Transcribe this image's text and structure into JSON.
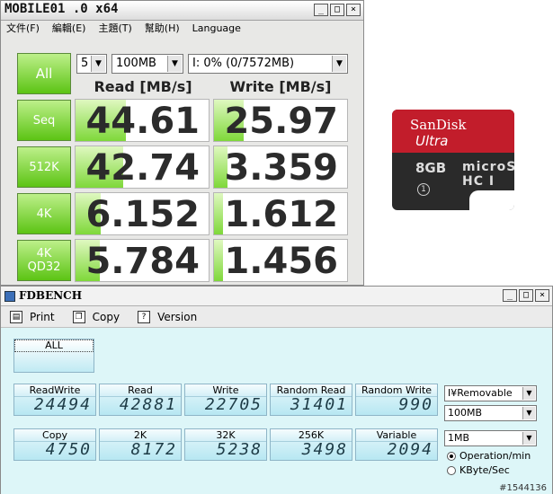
{
  "crystaldiskmark": {
    "title": "MOBILE01 .0 x64",
    "menu": [
      "文件(F)",
      "編輯(E)",
      "主題(T)",
      "幫助(H)",
      "Language"
    ],
    "all_label": "All",
    "count_select": "5",
    "size_select": "100MB",
    "drive_select": "I: 0% (0/7572MB)",
    "read_header": "Read [MB/s]",
    "write_header": "Write [MB/s]",
    "rows": [
      {
        "label": "Seq",
        "label2": "",
        "read": "44.61",
        "write": "25.97",
        "read_fill": 0.38,
        "write_fill": 0.22
      },
      {
        "label": "512K",
        "label2": "",
        "read": "42.74",
        "write": "3.359",
        "read_fill": 0.36,
        "write_fill": 0.1
      },
      {
        "label": "4K",
        "label2": "",
        "read": "6.152",
        "write": "1.612",
        "read_fill": 0.19,
        "write_fill": 0.07
      },
      {
        "label": "4K",
        "label2": "QD32",
        "read": "5.784",
        "write": "1.456",
        "read_fill": 0.18,
        "write_fill": 0.07
      }
    ],
    "window_buttons": [
      "_",
      "□",
      "×"
    ]
  },
  "sdcard": {
    "brand": "SanDisk",
    "line": "Ultra",
    "capacity": "8GB",
    "logo": "microSD HC I",
    "class": "1"
  },
  "fdbench": {
    "title": "FDBENCH",
    "toolbar": {
      "print": "Print",
      "copy": "Copy",
      "version": "Version"
    },
    "all_label": "ALL",
    "row1": [
      {
        "label": "ReadWrite",
        "value": "24494"
      },
      {
        "label": "Read",
        "value": "42881"
      },
      {
        "label": "Write",
        "value": "22705"
      },
      {
        "label": "Random Read",
        "value": "31401"
      },
      {
        "label": "Random Write",
        "value": "990"
      }
    ],
    "row2": [
      {
        "label": "Copy",
        "value": "4750"
      },
      {
        "label": "2K",
        "value": "8172"
      },
      {
        "label": "32K",
        "value": "5238"
      },
      {
        "label": "256K",
        "value": "3498"
      },
      {
        "label": "Variable",
        "value": "2094"
      }
    ],
    "drive_select": "I¥Removable",
    "size_select": "100MB",
    "block_select": "1MB",
    "radio_options": [
      "Operation/min",
      "KByte/Sec"
    ],
    "radio_selected": 0,
    "watermark": "#1544136",
    "window_buttons": [
      "_",
      "□",
      "×"
    ]
  }
}
